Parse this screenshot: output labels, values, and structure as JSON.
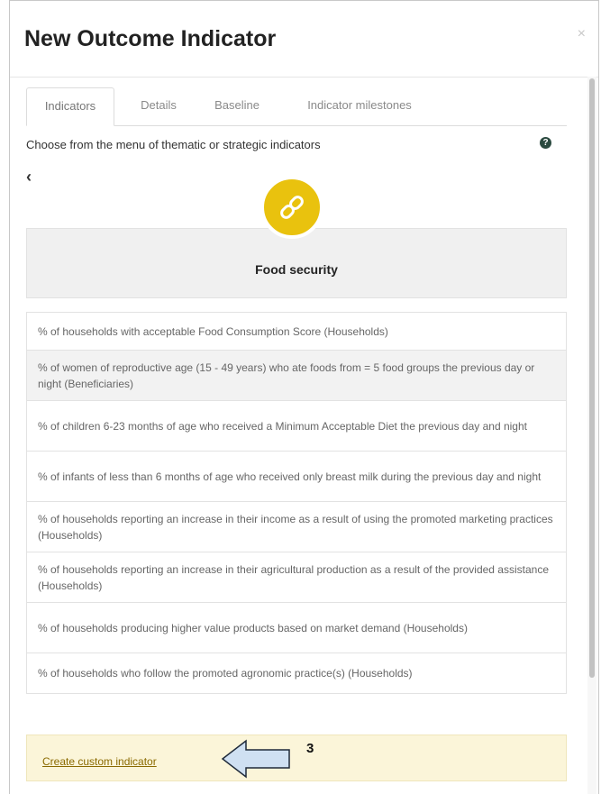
{
  "modal": {
    "title": "New Outcome Indicator",
    "close_icon": "×"
  },
  "tabs": [
    {
      "label": "Indicators",
      "active": true
    },
    {
      "label": "Details",
      "active": false
    },
    {
      "label": "Baseline",
      "active": false
    },
    {
      "label": "Indicator milestones",
      "active": false
    }
  ],
  "instruction": "Choose from the menu of thematic or strategic indicators",
  "help_icon": "?",
  "back_icon": "‹",
  "category": {
    "icon": "link-icon",
    "icon_color": "#e9c20e",
    "title": "Food security"
  },
  "indicators": [
    {
      "text": "% of households with acceptable Food Consumption Score (Households)"
    },
    {
      "text": "% of women of reproductive age (15 - 49 years) who ate foods from = 5 food groups the previous day or night (Beneficiaries)",
      "highlighted": true
    },
    {
      "text": "% of children 6-23 months of age who received a Minimum Acceptable Diet the previous day and night"
    },
    {
      "text": "% of infants of less than 6 months of age who received only breast milk during the previous day and night"
    },
    {
      "text": "% of households reporting an increase in their income as a result of using the promoted marketing practices (Households)"
    },
    {
      "text": "% of households reporting an increase in their agricultural production as a result of the provided assistance (Households)"
    },
    {
      "text": "% of households producing higher value products based on market demand (Households)"
    },
    {
      "text": "% of households who follow the promoted agronomic practice(s) (Households)"
    }
  ],
  "custom": {
    "link_label": "Create custom indicator",
    "background": "#fbf5d9"
  },
  "annotation": {
    "arrow": "left-arrow-icon",
    "step_number": "3",
    "arrow_fill": "#cfe0f2"
  }
}
